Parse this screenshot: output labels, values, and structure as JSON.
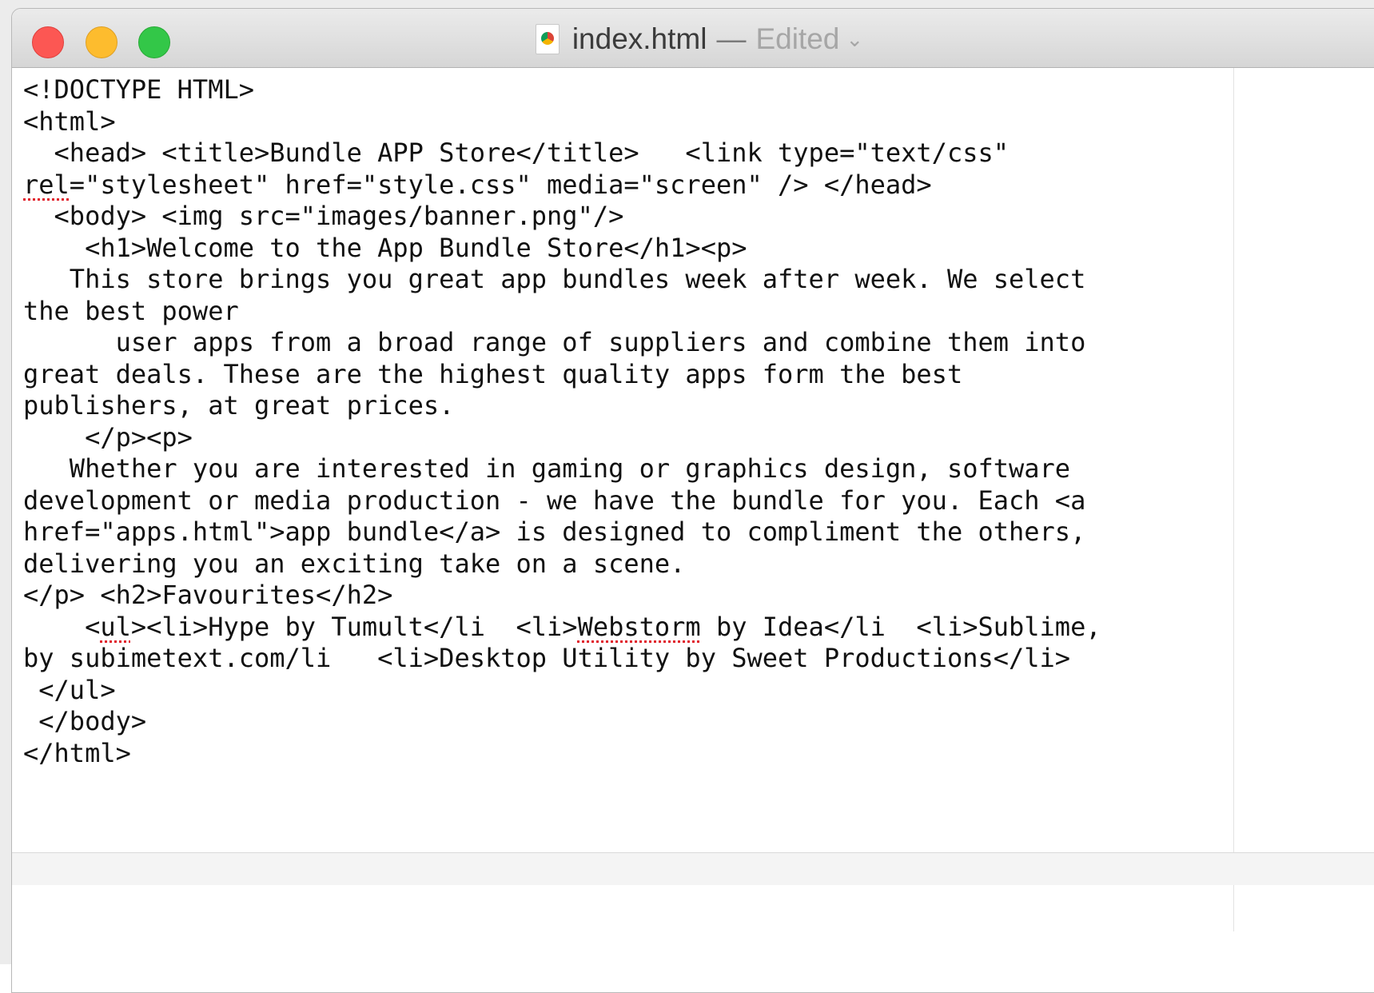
{
  "window": {
    "filename": "index.html",
    "separator": "—",
    "status": "Edited",
    "title_icon": "html-document-icon"
  },
  "colors": {
    "close": "#fc5753",
    "minimize": "#fdbc2e",
    "maximize": "#33c748",
    "spelling_underline": "#e0202a"
  },
  "editor": {
    "lines": [
      "<!DOCTYPE HTML>",
      "<html>",
      "  <head> <title>Bundle APP Store</title>   <link type=\"text/css\"",
      "rel=\"stylesheet\" href=\"style.css\" media=\"screen\" /> </head>",
      "  <body> <img src=\"images/banner.png\"/>",
      "    <h1>Welcome to the App Bundle Store</h1><p>",
      "   This store brings you great app bundles week after week. We select",
      "the best power",
      "      user apps from a broad range of suppliers and combine them into",
      "great deals. These are the highest quality apps form the best",
      "publishers, at great prices.",
      "    </p><p>",
      "   Whether you are interested in gaming or graphics design, software",
      "development or media production - we have the bundle for you. Each <a",
      "href=\"apps.html\">app bundle</a> is designed to compliment the others,",
      "delivering you an exciting take on a scene.",
      "</p> <h2>Favourites</h2>",
      "    <ul><li>Hype by Tumult</li  <li>Webstorm by Idea</li  <li>Sublime,",
      "by subimetext.com/li   <li>Desktop Utility by Sweet Productions</li>",
      " </ul>",
      " </body>",
      "</html>"
    ],
    "misspelled_words": [
      "rel",
      "ul",
      "Webstorm"
    ]
  }
}
